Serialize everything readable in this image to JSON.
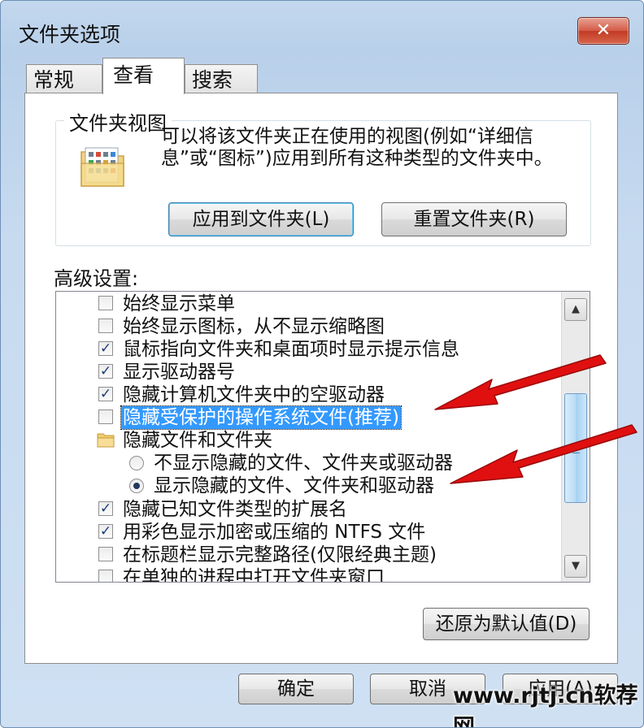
{
  "window": {
    "title": "文件夹选项",
    "close_glyph": "✕"
  },
  "tabs": [
    {
      "label": "常规"
    },
    {
      "label": "查看"
    },
    {
      "label": "搜索"
    }
  ],
  "folder_views": {
    "group_title": "文件夹视图",
    "description": "可以将该文件夹正在使用的视图(例如“详细信息”或“图标”)应用到所有这种类型的文件夹中。",
    "apply_button": "应用到文件夹(L)",
    "reset_button": "重置文件夹(R)",
    "icon": "folder-view-icon"
  },
  "advanced": {
    "label": "高级设置:",
    "items": [
      {
        "type": "checkbox",
        "label": "始终显示菜单",
        "checked": false
      },
      {
        "type": "checkbox",
        "label": "始终显示图标，从不显示缩略图",
        "checked": false
      },
      {
        "type": "checkbox",
        "label": "鼠标指向文件夹和桌面项时显示提示信息",
        "checked": true
      },
      {
        "type": "checkbox",
        "label": "显示驱动器号",
        "checked": true
      },
      {
        "type": "checkbox",
        "label": "隐藏计算机文件夹中的空驱动器",
        "checked": true
      },
      {
        "type": "checkbox",
        "label": "隐藏受保护的操作系统文件(推荐)",
        "checked": false,
        "selected": true
      },
      {
        "type": "folder",
        "label": "隐藏文件和文件夹"
      },
      {
        "type": "radio",
        "label": "不显示隐藏的文件、文件夹或驱动器",
        "checked": false
      },
      {
        "type": "radio",
        "label": "显示隐藏的文件、文件夹和驱动器",
        "checked": true
      },
      {
        "type": "checkbox",
        "label": "隐藏已知文件类型的扩展名",
        "checked": true
      },
      {
        "type": "checkbox",
        "label": "用彩色显示加密或压缩的 NTFS 文件",
        "checked": true
      },
      {
        "type": "checkbox",
        "label": "在标题栏显示完整路径(仅限经典主题)",
        "checked": false
      },
      {
        "type": "checkbox",
        "label": "在单独的进程中打开文件夹窗口",
        "checked": false
      }
    ],
    "check_glyph": "✓",
    "scroll_up_glyph": "▲",
    "scroll_down_glyph": "▼"
  },
  "restore_button": "还原为默认值(D)",
  "footer": {
    "ok": "确定",
    "cancel": "取消",
    "apply": "应用(A)"
  },
  "watermark": "www.rjtj.cn软荐网",
  "colors": {
    "selection": "#3399ff",
    "arrow": "#e01010",
    "close_button": "#c9432c"
  }
}
